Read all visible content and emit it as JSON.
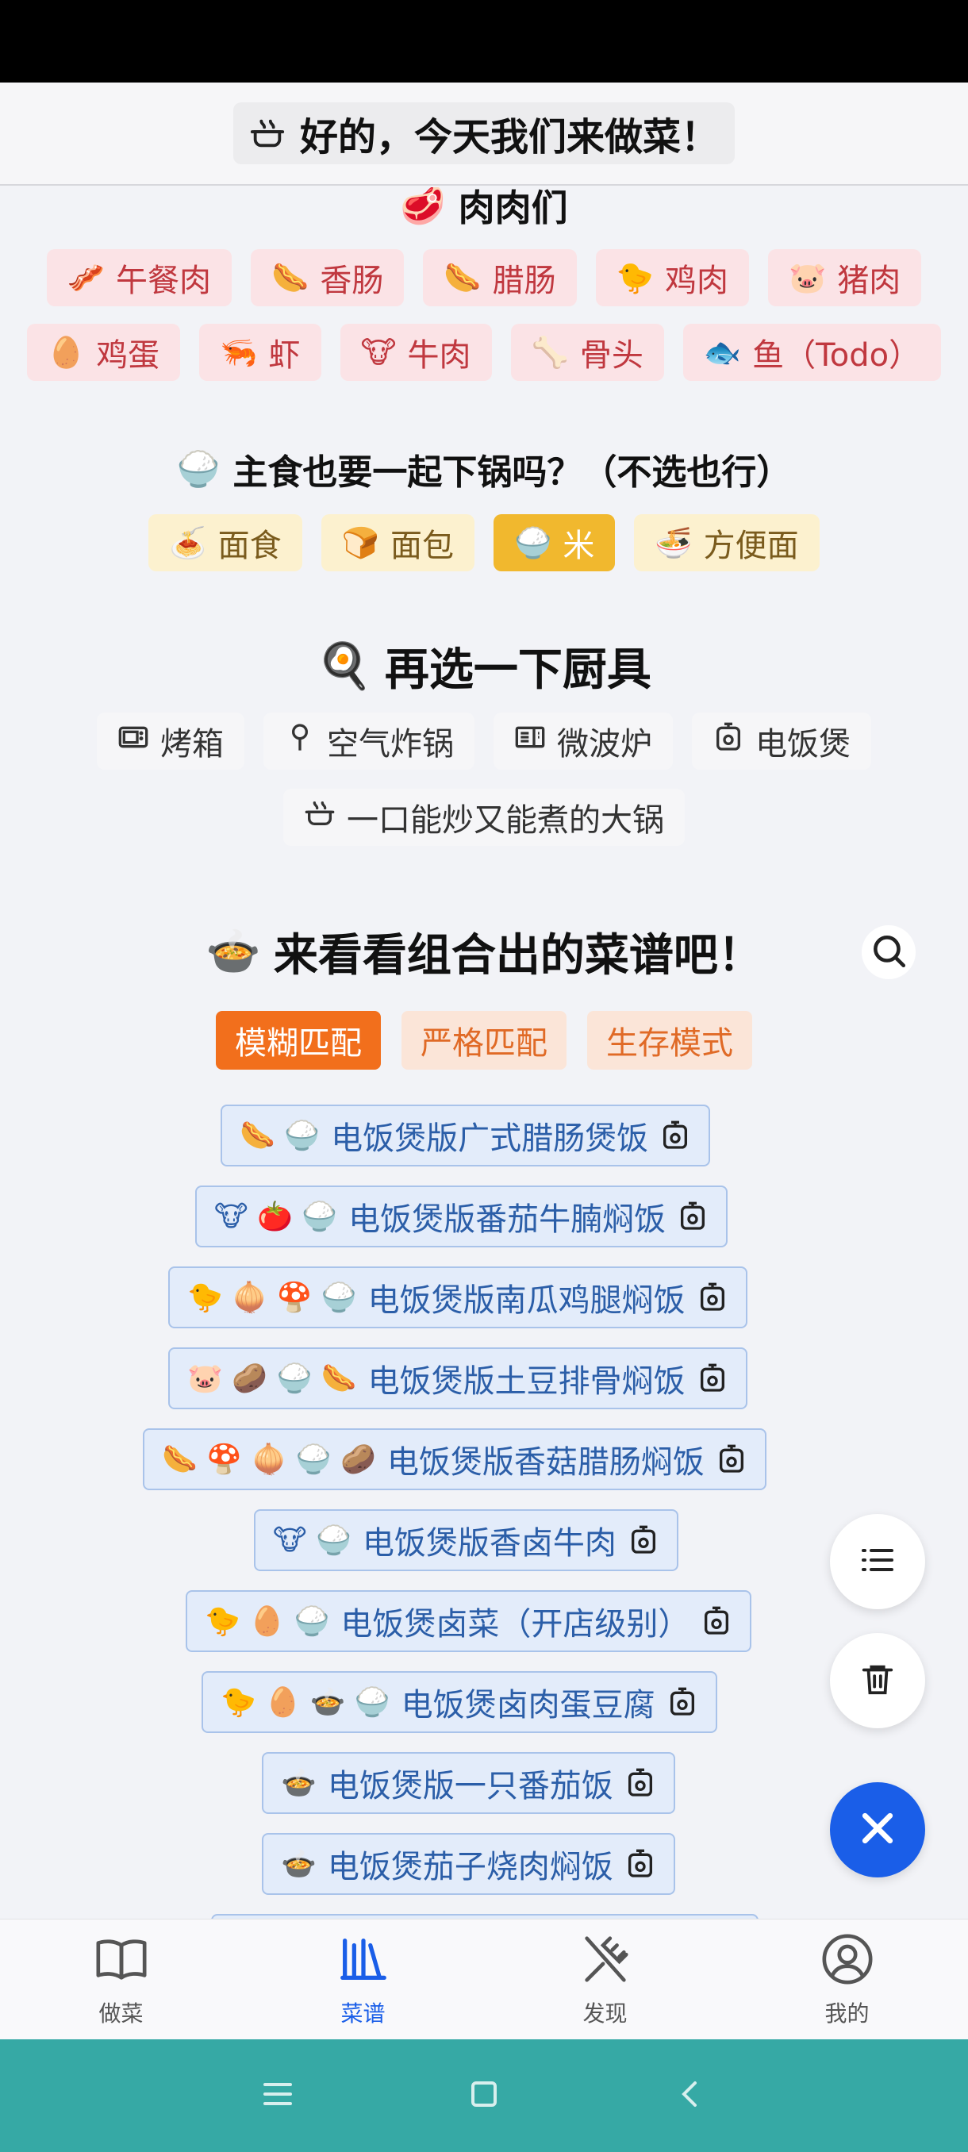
{
  "header": {
    "title": "好的，今天我们来做菜！"
  },
  "meats": {
    "title": "肉肉们",
    "title_emoji": "🥩",
    "row1": [
      {
        "emoji": "🥓",
        "label": "午餐肉"
      },
      {
        "emoji": "🌭",
        "label": "香肠"
      },
      {
        "emoji": "🌭",
        "label": "腊肠"
      },
      {
        "emoji": "🐤",
        "label": "鸡肉"
      },
      {
        "emoji": "🐷",
        "label": "猪肉"
      }
    ],
    "row2": [
      {
        "emoji": "🥚",
        "label": "鸡蛋"
      },
      {
        "emoji": "🦐",
        "label": "虾"
      },
      {
        "emoji": "🐮",
        "label": "牛肉"
      },
      {
        "emoji": "🦴",
        "label": "骨头"
      },
      {
        "emoji": "🐟",
        "label": "鱼（Todo）"
      }
    ]
  },
  "staples": {
    "title": "主食也要一起下锅吗？（不选也行）",
    "title_emoji": "🍚",
    "items": [
      {
        "emoji": "🍝",
        "label": "面食",
        "selected": false
      },
      {
        "emoji": "🍞",
        "label": "面包",
        "selected": false
      },
      {
        "emoji": "🍚",
        "label": "米",
        "selected": true
      },
      {
        "emoji": "🍜",
        "label": "方便面",
        "selected": false
      }
    ]
  },
  "tools": {
    "title": "再选一下厨具",
    "title_emoji": "🍳",
    "row1": [
      "烤箱",
      "空气炸锅",
      "微波炉",
      "电饭煲"
    ],
    "row2": [
      "一口能炒又能煮的大锅"
    ]
  },
  "results": {
    "title": "来看看组合出的菜谱吧！",
    "title_emoji": "🍲",
    "modes": [
      {
        "label": "模糊匹配",
        "active": true
      },
      {
        "label": "严格匹配",
        "active": false
      },
      {
        "label": "生存模式",
        "active": false
      }
    ],
    "recipes": [
      {
        "emojis": "🌭 🍚",
        "name": "电饭煲版广式腊肠煲饭"
      },
      {
        "emojis": "🐮 🍅 🍚",
        "name": "电饭煲版番茄牛腩焖饭"
      },
      {
        "emojis": "🐤 🧅 🍄 🍚",
        "name": "电饭煲版南瓜鸡腿焖饭"
      },
      {
        "emojis": "🐷 🥔 🍚 🌭",
        "name": "电饭煲版土豆排骨焖饭"
      },
      {
        "emojis": "🌭 🍄 🧅 🍚 🥔",
        "name": "电饭煲版香菇腊肠焖饭"
      },
      {
        "emojis": "🐮 🍚",
        "name": "电饭煲版香卤牛肉"
      },
      {
        "emojis": "🐤 🥚 🍚",
        "name": "电饭煲卤菜（开店级别）"
      },
      {
        "emojis": "🐤 🥚 🍲 🍚",
        "name": "电饭煲卤肉蛋豆腐"
      },
      {
        "emojis": "🍲",
        "name": "电饭煲版一只番茄饭"
      },
      {
        "emojis": "🍲",
        "name": "电饭煲茄子烧肉焖饭"
      }
    ]
  },
  "nav": [
    {
      "label": "做菜",
      "active": false
    },
    {
      "label": "菜谱",
      "active": true
    },
    {
      "label": "发现",
      "active": false
    },
    {
      "label": "我的",
      "active": false
    }
  ],
  "colors": {
    "accent_blue": "#1a5ee8",
    "meat_chip": "#fbe3e6",
    "staple_selected": "#f1b82e",
    "mode_active": "#f26f1c",
    "system_nav": "#36a9a5"
  }
}
